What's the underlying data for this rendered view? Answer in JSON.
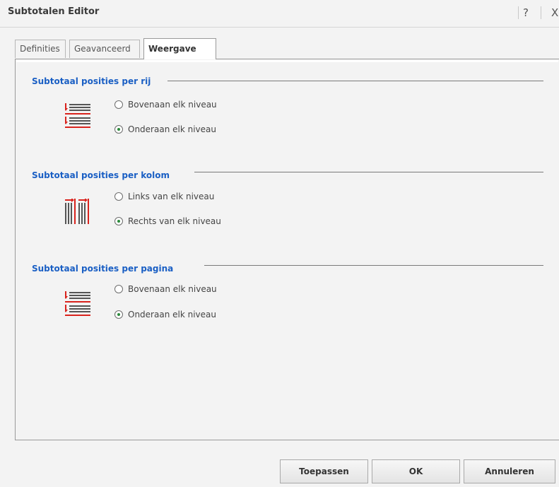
{
  "window": {
    "title": "Subtotalen Editor",
    "help_label": "?",
    "close_label": "X"
  },
  "tabs": [
    {
      "label": "Definities",
      "active": false
    },
    {
      "label": "Geavanceerd",
      "active": false
    },
    {
      "label": "Weergave",
      "active": true
    }
  ],
  "sections": [
    {
      "title": "Subtotaal posities per rij",
      "icon": "row-subtotal-icon",
      "options": [
        {
          "label": "Bovenaan elk niveau",
          "checked": false
        },
        {
          "label": "Onderaan elk niveau",
          "checked": true
        }
      ]
    },
    {
      "title": "Subtotaal posities per kolom",
      "icon": "column-subtotal-icon",
      "options": [
        {
          "label": "Links van elk niveau",
          "checked": false
        },
        {
          "label": "Rechts van elk niveau",
          "checked": true
        }
      ]
    },
    {
      "title": "Subtotaal posities per pagina",
      "icon": "page-subtotal-icon",
      "options": [
        {
          "label": "Bovenaan elk niveau",
          "checked": false
        },
        {
          "label": "Onderaan elk niveau",
          "checked": true
        }
      ]
    }
  ],
  "buttons": {
    "apply": "Toepassen",
    "ok": "OK",
    "cancel": "Annuleren"
  },
  "colors": {
    "section_title": "#1a5fc4",
    "icon_red": "#d9231d",
    "radio_checked": "#2c8a3c"
  }
}
